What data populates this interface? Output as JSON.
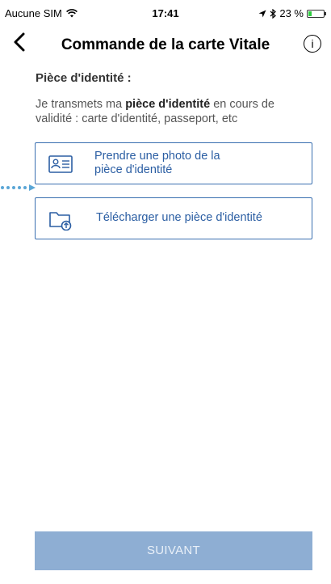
{
  "status_bar": {
    "carrier": "Aucune SIM",
    "time": "17:41",
    "battery_percent": "23 %",
    "battery_level": 0.23
  },
  "nav": {
    "title": "Commande de la carte Vitale",
    "back_icon": "chevron-left-icon",
    "info_icon": "info-icon"
  },
  "content": {
    "section_title": "Pièce d'identité :",
    "description_prefix": "Je transmets ma ",
    "description_bold": "pièce d'identité",
    "description_suffix": " en cours de validité : carte d'identité, passeport, etc"
  },
  "options": [
    {
      "label_line1": "Prendre une photo de la",
      "label_line2": "pièce d'identité",
      "icon": "id-card-icon"
    },
    {
      "label": "Télécharger une pièce d'identité",
      "icon": "folder-upload-icon"
    }
  ],
  "footer": {
    "next_label": "SUIVANT"
  },
  "colors": {
    "accent": "#2b5ea3",
    "border": "#3a6fb0",
    "disabled_button": "#8eaed3",
    "dots": "#5aa6d6"
  }
}
